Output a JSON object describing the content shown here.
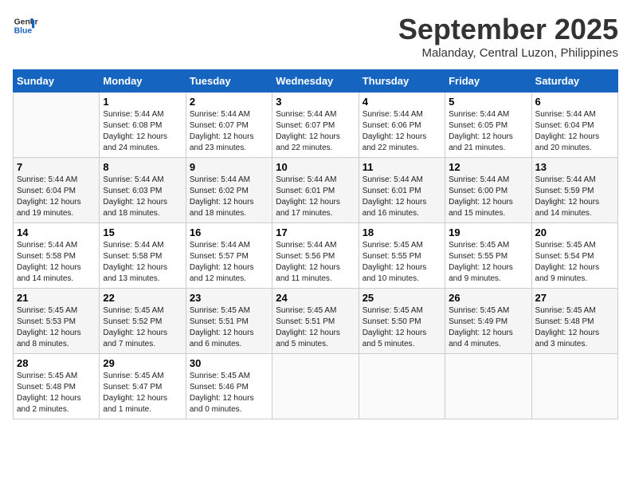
{
  "header": {
    "logo_line1": "General",
    "logo_line2": "Blue",
    "month_year": "September 2025",
    "location": "Malanday, Central Luzon, Philippines"
  },
  "days_of_week": [
    "Sunday",
    "Monday",
    "Tuesday",
    "Wednesday",
    "Thursday",
    "Friday",
    "Saturday"
  ],
  "weeks": [
    [
      {
        "num": "",
        "sunrise": "",
        "sunset": "",
        "daylight": ""
      },
      {
        "num": "1",
        "sunrise": "Sunrise: 5:44 AM",
        "sunset": "Sunset: 6:08 PM",
        "daylight": "Daylight: 12 hours and 24 minutes."
      },
      {
        "num": "2",
        "sunrise": "Sunrise: 5:44 AM",
        "sunset": "Sunset: 6:07 PM",
        "daylight": "Daylight: 12 hours and 23 minutes."
      },
      {
        "num": "3",
        "sunrise": "Sunrise: 5:44 AM",
        "sunset": "Sunset: 6:07 PM",
        "daylight": "Daylight: 12 hours and 22 minutes."
      },
      {
        "num": "4",
        "sunrise": "Sunrise: 5:44 AM",
        "sunset": "Sunset: 6:06 PM",
        "daylight": "Daylight: 12 hours and 22 minutes."
      },
      {
        "num": "5",
        "sunrise": "Sunrise: 5:44 AM",
        "sunset": "Sunset: 6:05 PM",
        "daylight": "Daylight: 12 hours and 21 minutes."
      },
      {
        "num": "6",
        "sunrise": "Sunrise: 5:44 AM",
        "sunset": "Sunset: 6:04 PM",
        "daylight": "Daylight: 12 hours and 20 minutes."
      }
    ],
    [
      {
        "num": "7",
        "sunrise": "Sunrise: 5:44 AM",
        "sunset": "Sunset: 6:04 PM",
        "daylight": "Daylight: 12 hours and 19 minutes."
      },
      {
        "num": "8",
        "sunrise": "Sunrise: 5:44 AM",
        "sunset": "Sunset: 6:03 PM",
        "daylight": "Daylight: 12 hours and 18 minutes."
      },
      {
        "num": "9",
        "sunrise": "Sunrise: 5:44 AM",
        "sunset": "Sunset: 6:02 PM",
        "daylight": "Daylight: 12 hours and 18 minutes."
      },
      {
        "num": "10",
        "sunrise": "Sunrise: 5:44 AM",
        "sunset": "Sunset: 6:01 PM",
        "daylight": "Daylight: 12 hours and 17 minutes."
      },
      {
        "num": "11",
        "sunrise": "Sunrise: 5:44 AM",
        "sunset": "Sunset: 6:01 PM",
        "daylight": "Daylight: 12 hours and 16 minutes."
      },
      {
        "num": "12",
        "sunrise": "Sunrise: 5:44 AM",
        "sunset": "Sunset: 6:00 PM",
        "daylight": "Daylight: 12 hours and 15 minutes."
      },
      {
        "num": "13",
        "sunrise": "Sunrise: 5:44 AM",
        "sunset": "Sunset: 5:59 PM",
        "daylight": "Daylight: 12 hours and 14 minutes."
      }
    ],
    [
      {
        "num": "14",
        "sunrise": "Sunrise: 5:44 AM",
        "sunset": "Sunset: 5:58 PM",
        "daylight": "Daylight: 12 hours and 14 minutes."
      },
      {
        "num": "15",
        "sunrise": "Sunrise: 5:44 AM",
        "sunset": "Sunset: 5:58 PM",
        "daylight": "Daylight: 12 hours and 13 minutes."
      },
      {
        "num": "16",
        "sunrise": "Sunrise: 5:44 AM",
        "sunset": "Sunset: 5:57 PM",
        "daylight": "Daylight: 12 hours and 12 minutes."
      },
      {
        "num": "17",
        "sunrise": "Sunrise: 5:44 AM",
        "sunset": "Sunset: 5:56 PM",
        "daylight": "Daylight: 12 hours and 11 minutes."
      },
      {
        "num": "18",
        "sunrise": "Sunrise: 5:45 AM",
        "sunset": "Sunset: 5:55 PM",
        "daylight": "Daylight: 12 hours and 10 minutes."
      },
      {
        "num": "19",
        "sunrise": "Sunrise: 5:45 AM",
        "sunset": "Sunset: 5:55 PM",
        "daylight": "Daylight: 12 hours and 9 minutes."
      },
      {
        "num": "20",
        "sunrise": "Sunrise: 5:45 AM",
        "sunset": "Sunset: 5:54 PM",
        "daylight": "Daylight: 12 hours and 9 minutes."
      }
    ],
    [
      {
        "num": "21",
        "sunrise": "Sunrise: 5:45 AM",
        "sunset": "Sunset: 5:53 PM",
        "daylight": "Daylight: 12 hours and 8 minutes."
      },
      {
        "num": "22",
        "sunrise": "Sunrise: 5:45 AM",
        "sunset": "Sunset: 5:52 PM",
        "daylight": "Daylight: 12 hours and 7 minutes."
      },
      {
        "num": "23",
        "sunrise": "Sunrise: 5:45 AM",
        "sunset": "Sunset: 5:51 PM",
        "daylight": "Daylight: 12 hours and 6 minutes."
      },
      {
        "num": "24",
        "sunrise": "Sunrise: 5:45 AM",
        "sunset": "Sunset: 5:51 PM",
        "daylight": "Daylight: 12 hours and 5 minutes."
      },
      {
        "num": "25",
        "sunrise": "Sunrise: 5:45 AM",
        "sunset": "Sunset: 5:50 PM",
        "daylight": "Daylight: 12 hours and 5 minutes."
      },
      {
        "num": "26",
        "sunrise": "Sunrise: 5:45 AM",
        "sunset": "Sunset: 5:49 PM",
        "daylight": "Daylight: 12 hours and 4 minutes."
      },
      {
        "num": "27",
        "sunrise": "Sunrise: 5:45 AM",
        "sunset": "Sunset: 5:48 PM",
        "daylight": "Daylight: 12 hours and 3 minutes."
      }
    ],
    [
      {
        "num": "28",
        "sunrise": "Sunrise: 5:45 AM",
        "sunset": "Sunset: 5:48 PM",
        "daylight": "Daylight: 12 hours and 2 minutes."
      },
      {
        "num": "29",
        "sunrise": "Sunrise: 5:45 AM",
        "sunset": "Sunset: 5:47 PM",
        "daylight": "Daylight: 12 hours and 1 minute."
      },
      {
        "num": "30",
        "sunrise": "Sunrise: 5:45 AM",
        "sunset": "Sunset: 5:46 PM",
        "daylight": "Daylight: 12 hours and 0 minutes."
      },
      {
        "num": "",
        "sunrise": "",
        "sunset": "",
        "daylight": ""
      },
      {
        "num": "",
        "sunrise": "",
        "sunset": "",
        "daylight": ""
      },
      {
        "num": "",
        "sunrise": "",
        "sunset": "",
        "daylight": ""
      },
      {
        "num": "",
        "sunrise": "",
        "sunset": "",
        "daylight": ""
      }
    ]
  ]
}
